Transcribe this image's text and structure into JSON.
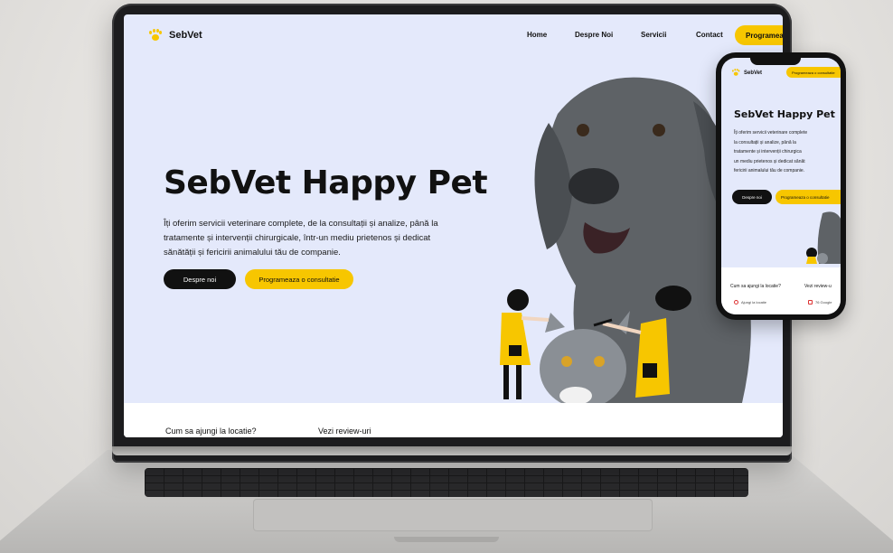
{
  "site": {
    "brand": "SebVet",
    "nav": {
      "links": [
        "Home",
        "Despre Noi",
        "Servicii",
        "Contact"
      ],
      "cta": "Programeaza"
    },
    "hero": {
      "title": "SebVet Happy Pet",
      "description_lines": [
        "Îți oferim servicii veterinare complete, de la consultații și analize, până la",
        "tratamente și intervenții chirurgicale, într-un mediu prietenos și dedicat",
        "sănătății și fericirii animalului tău de companie."
      ],
      "primary_button": "Despre noi",
      "secondary_button": "Programeaza o consultatie"
    },
    "bottom": {
      "location_link": "Cum sa ajungi la locatie?",
      "reviews_link": "Vezi review-uri"
    }
  },
  "mobile": {
    "brand": "SebVet",
    "cta": "Programeaza o consultatie",
    "title": "SebVet Happy Pet",
    "description_lines": [
      "Îți oferim servicii veterinare complete",
      "la consultații și analize, până la",
      "tratamente și intervenții chirurgica",
      "un mediu prietenos și dedicat sănăt",
      "fericirii animalului tău de companie."
    ],
    "primary_button": "Despre noi",
    "secondary_button": "Programeaza o consultatie",
    "location_link": "Cum sa ajungi la locatie?",
    "reviews_link": "Vezi review-u",
    "location_chip": "Ajungi la locatie",
    "reviews_chip": "76 Google"
  },
  "colors": {
    "accent": "#f7c600",
    "hero_bg": "#e4e9fb",
    "dark": "#111111"
  },
  "icons": [
    "paw-icon",
    "location-pin-icon",
    "google-icon"
  ]
}
